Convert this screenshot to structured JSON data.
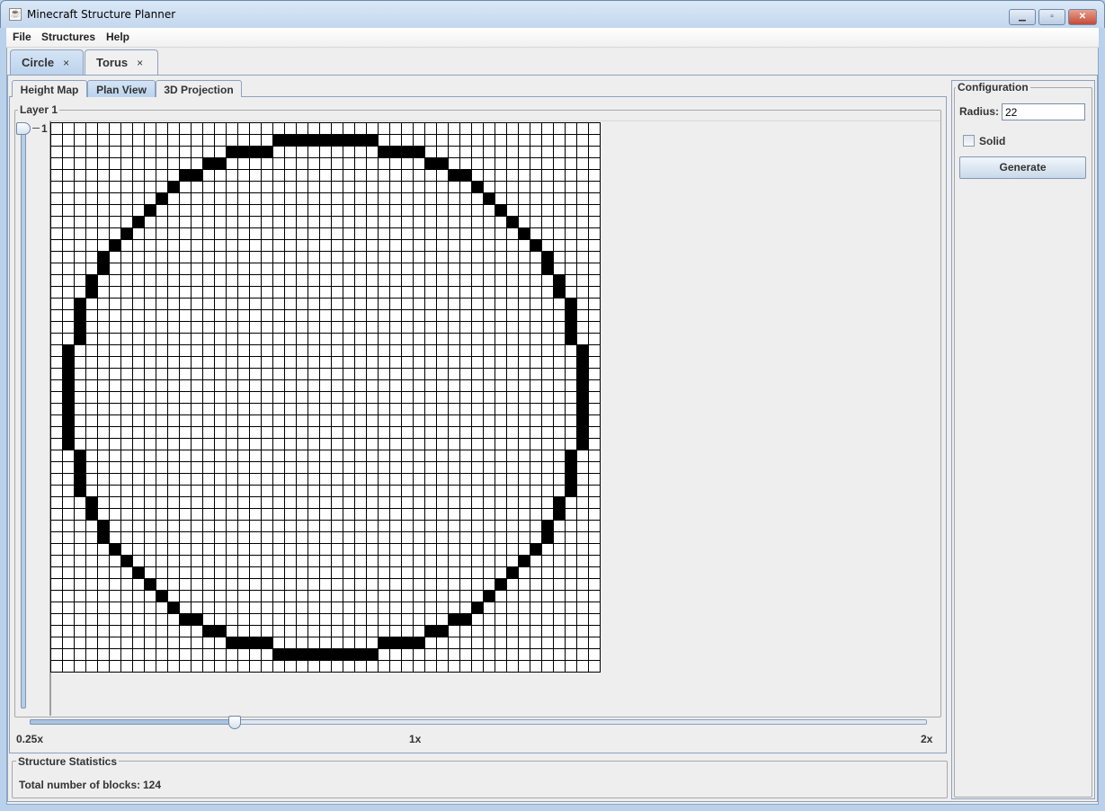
{
  "window": {
    "title": "Minecraft Structure Planner",
    "controls": [
      "minimize",
      "maximize",
      "close"
    ]
  },
  "menu": [
    "File",
    "Structures",
    "Help"
  ],
  "document_tabs": [
    {
      "label": "Circle",
      "selected": true
    },
    {
      "label": "Torus",
      "selected": false
    }
  ],
  "close_glyph": "×",
  "view_tabs": [
    {
      "label": "Height Map",
      "selected": false
    },
    {
      "label": "Plan View",
      "selected": true
    },
    {
      "label": "3D Projection",
      "selected": false
    }
  ],
  "layer": {
    "title": "Layer 1",
    "slider_value": "1"
  },
  "plan": {
    "radius": 22,
    "solid": false,
    "block_color": "#000000",
    "empty_color": "#ffffff"
  },
  "zoom": {
    "min_label": "0.25x",
    "mid_label": "1x",
    "max_label": "2x",
    "value": 0.65
  },
  "config": {
    "title": "Configuration",
    "radius_label": "Radius:",
    "radius_value": "22",
    "solid_label": "Solid",
    "solid_checked": false,
    "generate_label": "Generate"
  },
  "stats": {
    "title": "Structure Statistics",
    "label": "Total number of blocks:",
    "value": "124"
  }
}
